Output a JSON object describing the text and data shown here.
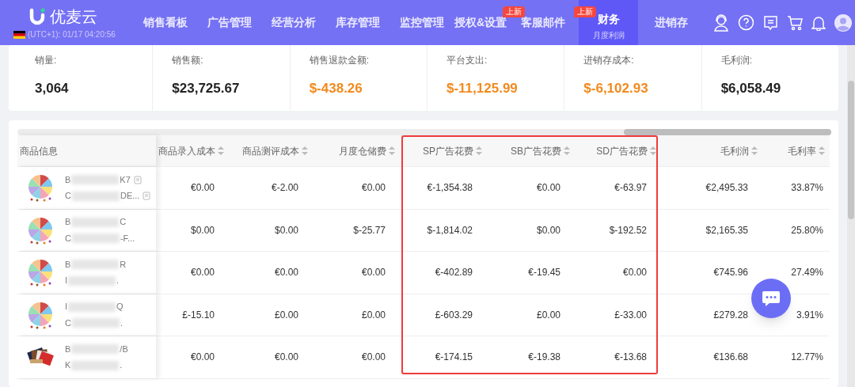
{
  "app": {
    "name": "优麦云",
    "timezone": "(UTC+1): 01/17 04:20:56"
  },
  "nav": [
    {
      "label": "销售看板",
      "selected": false
    },
    {
      "label": "广告管理",
      "selected": false
    },
    {
      "label": "经营分析",
      "selected": false
    },
    {
      "label": "库存管理",
      "selected": false
    },
    {
      "label": "监控管理",
      "selected": false
    },
    {
      "label": "授权&设置",
      "selected": false,
      "badge": "上新"
    },
    {
      "label": "客服邮件",
      "selected": false,
      "badge": "上新"
    },
    {
      "label": "财务",
      "selected": true,
      "sublabel": "月度利润"
    },
    {
      "label": "进销存",
      "selected": false
    }
  ],
  "summary": [
    {
      "label": "销量:",
      "value": "3,064",
      "negative": false
    },
    {
      "label": "销售额:",
      "value": "$23,725.67",
      "negative": false
    },
    {
      "label": "销售退款金额:",
      "value": "$-438.26",
      "negative": true
    },
    {
      "label": "平台支出:",
      "value": "$-11,125.99",
      "negative": true
    },
    {
      "label": "进销存成本:",
      "value": "$-6,102.93",
      "negative": true
    },
    {
      "label": "毛利润:",
      "value": "$6,058.49",
      "negative": false
    }
  ],
  "table": {
    "product_column": "商品信息",
    "columns": [
      {
        "label": "商品录入成本",
        "highlighted": false
      },
      {
        "label": "商品测评成本",
        "highlighted": false
      },
      {
        "label": "月度仓储费",
        "highlighted": false
      },
      {
        "label": "SP广告花费",
        "highlighted": true
      },
      {
        "label": "SB广告花费",
        "highlighted": true
      },
      {
        "label": "SD广告花费",
        "highlighted": true
      },
      {
        "label": "毛利润",
        "highlighted": false
      },
      {
        "label": "毛利率",
        "highlighted": false
      }
    ],
    "rows": [
      {
        "product": {
          "line1": [
            "B",
            "K7"
          ],
          "line2": [
            "C",
            "DE..."
          ],
          "copy": true
        },
        "cells": [
          "€0.00",
          "€-2.00",
          "€0.00",
          "€-1,354.38",
          "€0.00",
          "€-63.97",
          "€2,495.33",
          "33.87%"
        ]
      },
      {
        "product": {
          "line1": [
            "B",
            "C"
          ],
          "line2": [
            "C",
            "-F..."
          ],
          "copy": false
        },
        "cells": [
          "$0.00",
          "$0.00",
          "$-25.77",
          "$-1,814.02",
          "$0.00",
          "$-192.52",
          "$2,165.35",
          "25.80%"
        ]
      },
      {
        "product": {
          "line1": [
            "B",
            "R"
          ],
          "line2": [
            "I",
            "."
          ],
          "copy": false
        },
        "cells": [
          "€0.00",
          "€0.00",
          "€0.00",
          "€-402.89",
          "€-19.45",
          "€0.00",
          "€745.96",
          "27.49%"
        ]
      },
      {
        "product": {
          "line1": [
            "I",
            "Q"
          ],
          "line2": [
            "C",
            "."
          ],
          "copy": false
        },
        "cells": [
          "£-15.10",
          "£0.00",
          "£0.00",
          "£-603.29",
          "£0.00",
          "£-33.00",
          "£279.28",
          "3.91%"
        ]
      },
      {
        "product": {
          "line1": [
            "B",
            "/B"
          ],
          "line2": [
            "K",
            "."
          ],
          "copy": false
        },
        "cells": [
          "€0.00",
          "€0.00",
          "€0.00",
          "€-174.15",
          "€-19.38",
          "€-13.68",
          "€136.68",
          "12.77%"
        ]
      }
    ]
  }
}
